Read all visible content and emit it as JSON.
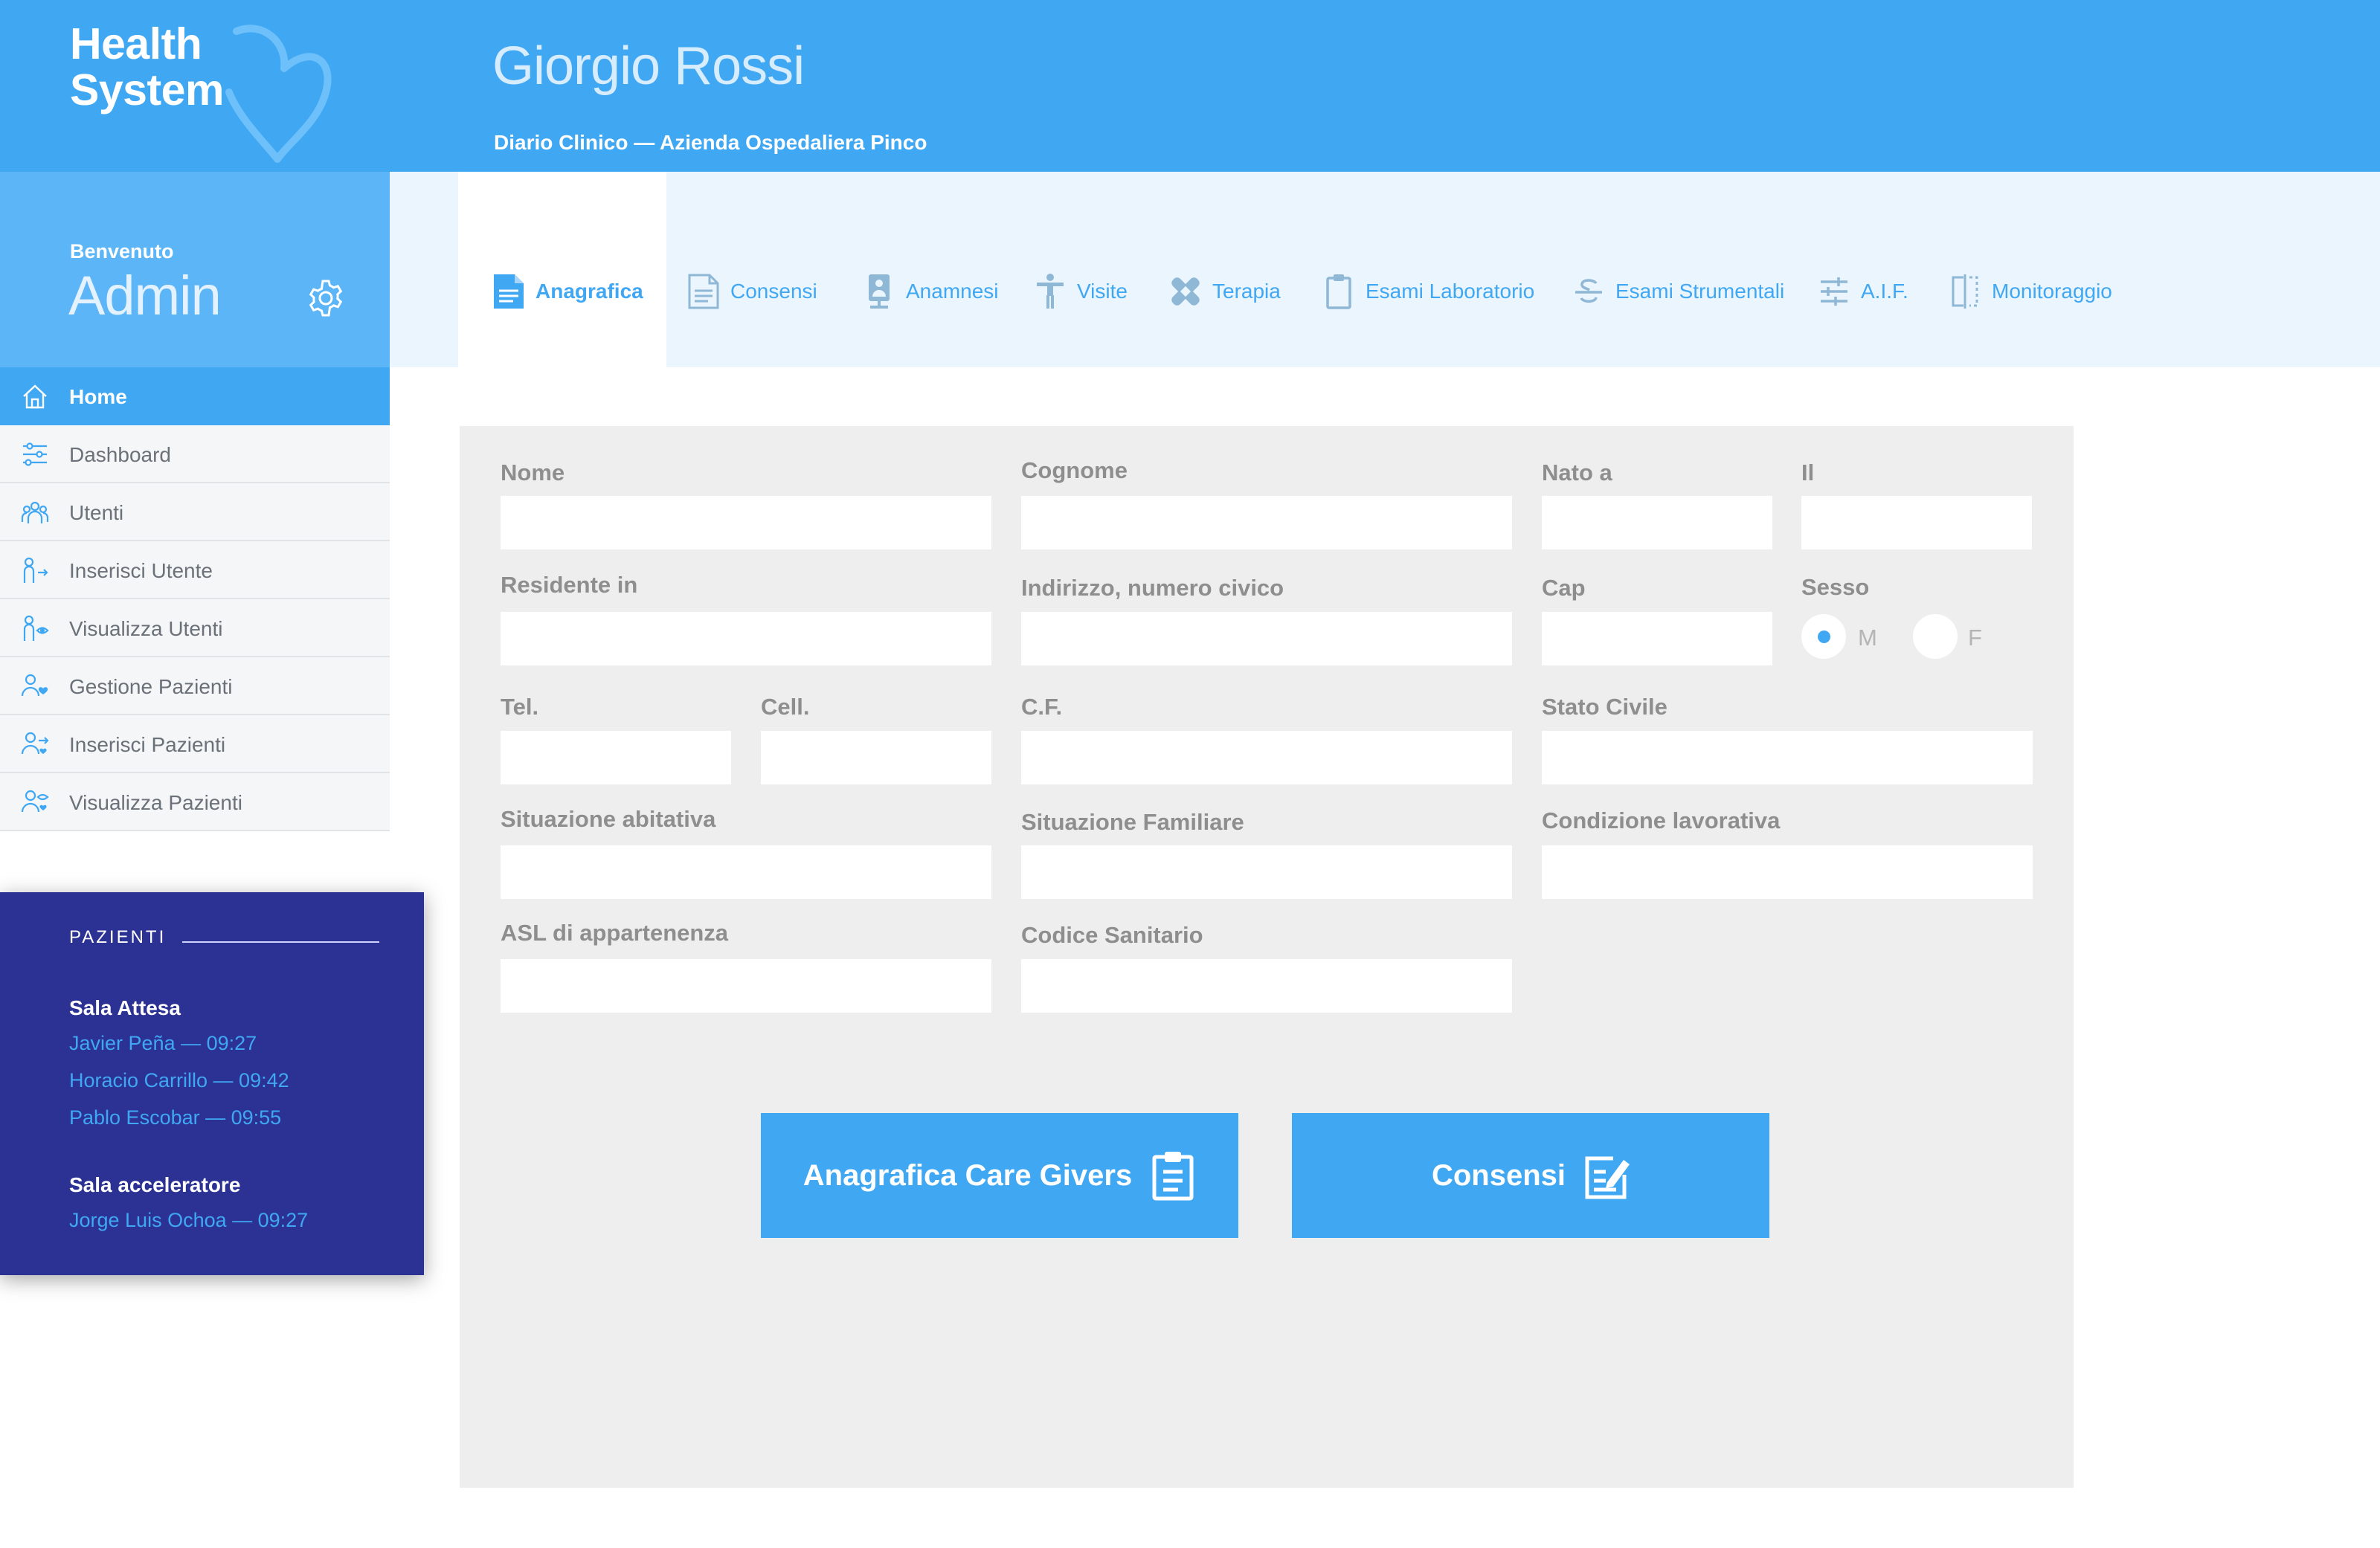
{
  "app": {
    "logo_line1": "Health",
    "logo_line2": "System",
    "brand_color": "#40a7f3"
  },
  "header": {
    "patient_name": "Giorgio Rossi",
    "subtitle": "Diario Clinico — Azienda Ospedaliera Pinco"
  },
  "user": {
    "welcome": "Benvenuto",
    "role": "Admin"
  },
  "sidebar": {
    "items": [
      {
        "label": "Home",
        "icon": "home-icon",
        "active": true
      },
      {
        "label": "Dashboard",
        "icon": "sliders-icon"
      },
      {
        "label": "Utenti",
        "icon": "users-icon"
      },
      {
        "label": "Inserisci Utente",
        "icon": "user-add-icon"
      },
      {
        "label": "Visualizza Utenti",
        "icon": "user-view-icon"
      },
      {
        "label": "Gestione Pazienti",
        "icon": "patient-manage-icon"
      },
      {
        "label": "Inserisci Pazienti",
        "icon": "patient-add-icon"
      },
      {
        "label": "Visualizza Pazienti",
        "icon": "patient-view-icon"
      }
    ]
  },
  "patients": {
    "heading": "PAZIENTI",
    "rooms": [
      {
        "name": "Sala Attesa",
        "entries": [
          "Javier Peña — 09:27",
          "Horacio Carrillo — 09:42",
          "Pablo Escobar — 09:55"
        ]
      },
      {
        "name": "Sala acceleratore",
        "entries": [
          "Jorge Luis Ochoa — 09:27"
        ]
      }
    ]
  },
  "tabs": [
    {
      "label": "Anagrafica",
      "icon": "document-icon",
      "active": true
    },
    {
      "label": "Consensi",
      "icon": "document-lines-icon"
    },
    {
      "label": "Anamnesi",
      "icon": "id-card-icon"
    },
    {
      "label": "Visite",
      "icon": "person-icon"
    },
    {
      "label": "Terapia",
      "icon": "bandage-icon"
    },
    {
      "label": "Esami Laboratorio",
      "icon": "clipboard-icon"
    },
    {
      "label": "Esami Strumentali",
      "icon": "strikethrough-icon"
    },
    {
      "label": "A.I.F.",
      "icon": "tune-icon"
    },
    {
      "label": "Monitoraggio",
      "icon": "compare-icon"
    }
  ],
  "form": {
    "nome": "Nome",
    "cognome": "Cognome",
    "nato_a": "Nato a",
    "il": "Il",
    "residente_in": "Residente in",
    "indirizzo": "Indirizzo, numero civico",
    "cap": "Cap",
    "sesso": "Sesso",
    "sesso_m": "M",
    "sesso_f": "F",
    "sesso_selected": "M",
    "tel": "Tel.",
    "cell": "Cell.",
    "cf": "C.F.",
    "stato_civile": "Stato Civile",
    "situazione_abitativa": "Situazione abitativa",
    "situazione_familiare": "Situazione Familiare",
    "condizione_lavorativa": "Condizione lavorativa",
    "asl": "ASL di appartenenza",
    "codice_sanitario": "Codice Sanitario"
  },
  "buttons": {
    "care_givers": "Anagrafica Care Givers",
    "consensi": "Consensi"
  }
}
